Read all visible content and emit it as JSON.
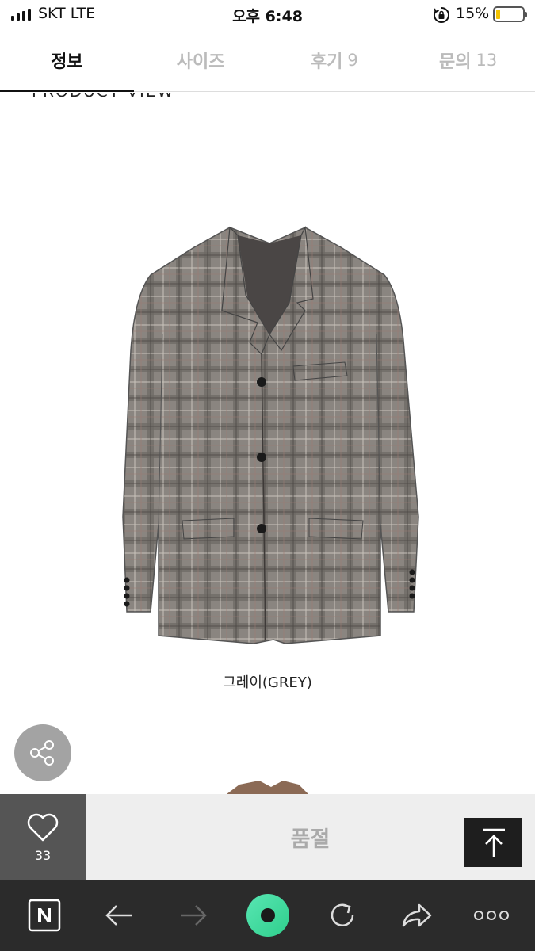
{
  "status_bar": {
    "carrier": "SKT  LTE",
    "time": "오후 6:48",
    "battery": "15%",
    "battery_level": 0.15
  },
  "tabs": [
    {
      "label": "정보",
      "count": "",
      "active": true
    },
    {
      "label": "사이즈",
      "count": "",
      "active": false
    },
    {
      "label": "후기",
      "count": "9",
      "active": false
    },
    {
      "label": "문의",
      "count": "13",
      "active": false
    }
  ],
  "content": {
    "section_heading": "PRODUCT VIEW",
    "product_caption": "그레이(GREY)"
  },
  "buy_bar": {
    "like_count": "33",
    "status_label": "품절"
  },
  "icons": {
    "share": "share-icon",
    "back": "chevron-left-icon",
    "scroll_top": "arrow-to-top-icon",
    "like": "heart-icon"
  },
  "colors": {
    "tab_active": "#111111",
    "tab_inactive": "#bbbbbb",
    "like_bg": "#555555",
    "toolbar_bg": "#2b2b2b",
    "accent_green": "#3cd9a0"
  }
}
